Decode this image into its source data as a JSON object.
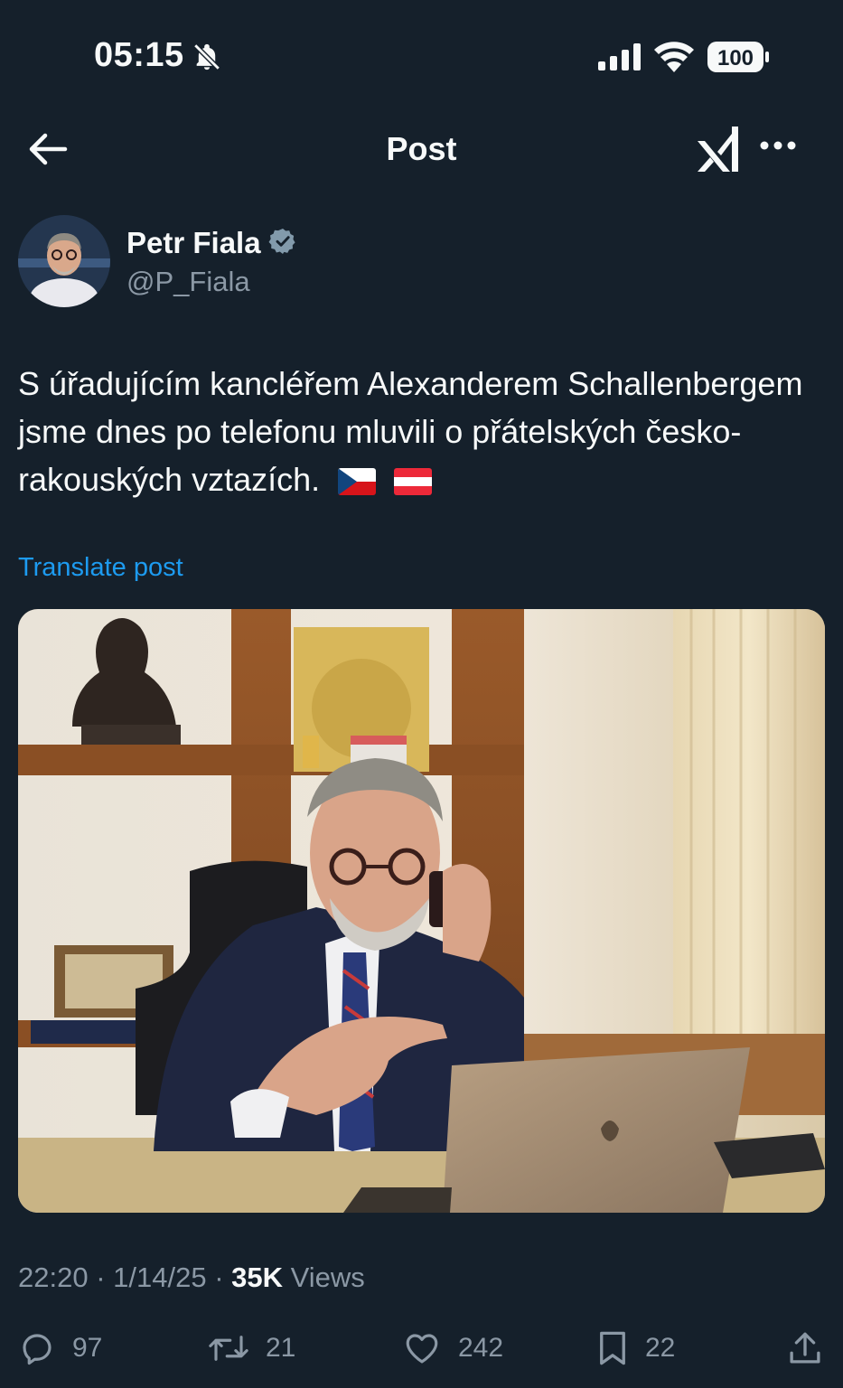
{
  "status": {
    "time": "05:15",
    "battery": "100"
  },
  "nav": {
    "title": "Post"
  },
  "author": {
    "name": "Petr Fiala",
    "handle": "@P_Fiala"
  },
  "post": {
    "text": "S úřadujícím kancléřem Alexanderem Schallenbergem jsme dnes po telefonu mluvili o přátelských česko-rakouských vztazích.",
    "flags": [
      "cz-flag-emoji",
      "at-flag-emoji"
    ],
    "translate_label": "Translate post",
    "time": "22:20",
    "date": "1/14/25",
    "views_count": "35K",
    "views_label": "Views"
  },
  "actions": {
    "replies": "97",
    "reposts": "21",
    "likes": "242",
    "bookmarks": "22"
  },
  "colors": {
    "background": "#15202b",
    "accent": "#1d9bf0",
    "muted": "#8b98a5",
    "text": "#f7f9f9"
  }
}
